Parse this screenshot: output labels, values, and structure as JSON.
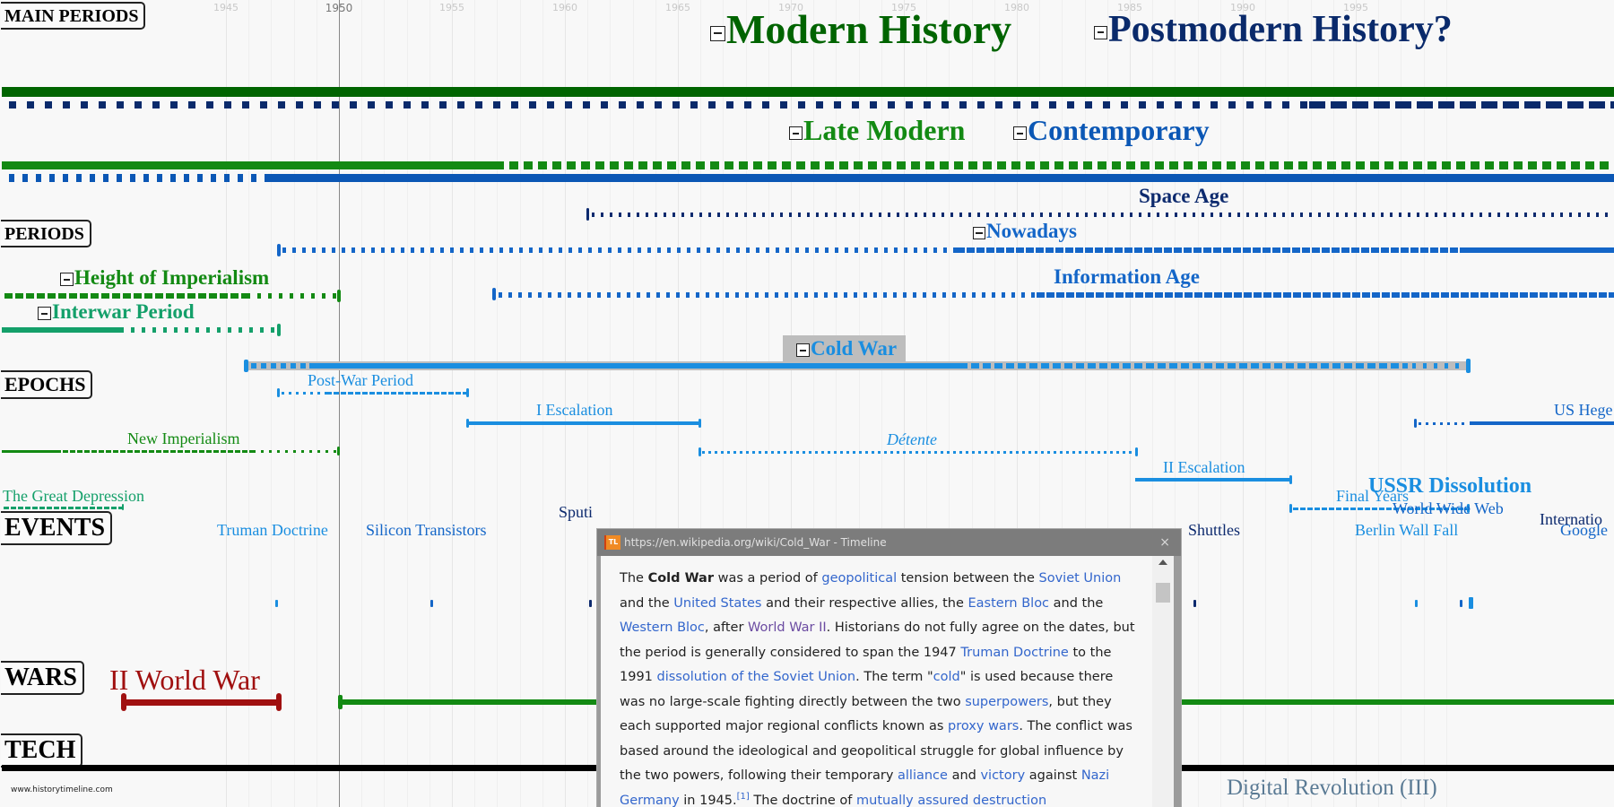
{
  "axis": {
    "ticks": [
      {
        "year": 1945,
        "label": "1945"
      },
      {
        "year": 1950,
        "label": "1950",
        "current": true
      },
      {
        "year": 1955,
        "label": "1955"
      },
      {
        "year": 1960,
        "label": "1960"
      },
      {
        "year": 1965,
        "label": "1965"
      },
      {
        "year": 1970,
        "label": "1970"
      },
      {
        "year": 1975,
        "label": "1975"
      },
      {
        "year": 1980,
        "label": "1980"
      },
      {
        "year": 1985,
        "label": "1985"
      },
      {
        "year": 1990,
        "label": "1990"
      },
      {
        "year": 1995,
        "label": "1995"
      }
    ]
  },
  "sections": {
    "main_periods": "MAIN PERIODS",
    "periods": "PERIODS",
    "epochs": "EPOCHS",
    "events": "EVENTS",
    "wars": "WARS",
    "tech": "TECH"
  },
  "main_periods": {
    "modern_history": {
      "label": "Modern History",
      "color": "#006400"
    },
    "postmodern_history": {
      "label": "Postmodern History?",
      "color": "#0a2a6b"
    },
    "late_modern": {
      "label": "Late Modern",
      "color": "#138a13"
    },
    "contemporary": {
      "label": "Contemporary",
      "color": "#0b57b5"
    }
  },
  "periods": {
    "space_age": {
      "label": "Space Age",
      "color": "#0d2a6e",
      "start": 1957
    },
    "nowadays": {
      "label": "Nowadays",
      "color": "#1466c8",
      "start": 1945
    },
    "information_age": {
      "label": "Information Age",
      "color": "#1466c8",
      "start": 1954
    },
    "height_of_imperialism": {
      "label": "Height of Imperialism",
      "color": "#138a13",
      "end": 1950
    },
    "interwar_period": {
      "label": "Interwar Period",
      "color": "#14a06a",
      "end": 1945
    }
  },
  "epochs": {
    "cold_war": {
      "label": "Cold War",
      "color": "#1a8ee0",
      "start": 1947,
      "end": 1991
    },
    "post_war_period": {
      "label": "Post-War Period",
      "color": "#1a8ee0",
      "start": 1945,
      "end": 1953
    },
    "i_escalation": {
      "label": "I Escalation",
      "color": "#1a8ee0",
      "start": 1953,
      "end": 1962
    },
    "new_imperialism": {
      "label": "New Imperialism",
      "color": "#138a13",
      "end": 1950
    },
    "detente": {
      "label": "Détente",
      "color": "#1a8ee0",
      "start": 1962,
      "end": 1979
    },
    "ii_escalation": {
      "label": "II Escalation",
      "color": "#1a8ee0",
      "start": 1979,
      "end": 1985
    },
    "final_years": {
      "label": "Final Years",
      "color": "#1a8ee0",
      "start": 1985,
      "end": 1991
    },
    "great_depression": {
      "label": "The Great Depression",
      "color": "#14a06a"
    },
    "us_hegemony": {
      "label": "US Hege",
      "color": "#1466c8",
      "start": 1989
    }
  },
  "events": [
    {
      "label": "Truman Doctrine",
      "year": 1947,
      "color": "#1a8ee0"
    },
    {
      "label": "Silicon Transistors",
      "year": 1954,
      "color": "#1466c8"
    },
    {
      "label": "Sputi",
      "year": 1957,
      "color": "#0d2a6e"
    },
    {
      "label": "Shuttles",
      "year": 1981,
      "color": "#0d2a6e"
    },
    {
      "label": "Berlin Wall Fall",
      "year": 1989,
      "color": "#1a8ee0"
    },
    {
      "label": "World Wide Web",
      "year": 1990,
      "color": "#1466c8"
    },
    {
      "label": "USSR Dissolution",
      "year": 1991,
      "color": "#1a8ee0"
    },
    {
      "label": "Internatio",
      "year": 1996,
      "color": "#0d2a6e"
    },
    {
      "label": "Google",
      "year": 1998,
      "color": "#1466c8"
    }
  ],
  "wars": {
    "ii_world_war": {
      "label": "II World War",
      "color": "#a01010",
      "start": 1939,
      "end": 1945
    }
  },
  "tech": {
    "digital_revolution": {
      "label": "Digital Revolution (III)",
      "color": "#5a7a94"
    }
  },
  "footer": "www.historytimeline.com",
  "popup": {
    "favicon": "TL",
    "title": "https://en.wikipedia.org/wiki/Cold_War - Timeline",
    "close": "×",
    "segments": [
      {
        "t": "The "
      },
      {
        "t": "Cold War",
        "b": true
      },
      {
        "t": " was a period of "
      },
      {
        "t": "geopolitical",
        "a": true
      },
      {
        "t": " tension between the "
      },
      {
        "t": "Soviet Union",
        "a": true
      },
      {
        "t": " and the "
      },
      {
        "t": "United States",
        "a": true
      },
      {
        "t": " and their respective allies, the "
      },
      {
        "t": "Eastern Bloc",
        "a": true
      },
      {
        "t": " and the "
      },
      {
        "t": "Western Bloc",
        "a": true
      },
      {
        "t": ", after "
      },
      {
        "t": "World War II",
        "a": true,
        "v": true
      },
      {
        "t": ". Historians do not fully agree on the dates, but the period is generally considered to span the 1947 "
      },
      {
        "t": "Truman Doctrine",
        "a": true
      },
      {
        "t": " to the 1991 "
      },
      {
        "t": "dissolution of the Soviet Union",
        "a": true
      },
      {
        "t": ". The term \""
      },
      {
        "t": "cold",
        "a": true
      },
      {
        "t": "\" is used because there was no large-scale fighting directly between the two "
      },
      {
        "t": "superpowers",
        "a": true
      },
      {
        "t": ", but they each supported major regional conflicts known as "
      },
      {
        "t": "proxy wars",
        "a": true
      },
      {
        "t": ". The conflict was based around the ideological and geopolitical struggle for global influence by the two powers, following their temporary "
      },
      {
        "t": "alliance",
        "a": true
      },
      {
        "t": " and "
      },
      {
        "t": "victory",
        "a": true
      },
      {
        "t": " against "
      },
      {
        "t": "Nazi Germany",
        "a": true
      },
      {
        "t": " in 1945."
      },
      {
        "t": "[1]",
        "sup": true,
        "a": true
      },
      {
        "t": " The doctrine of "
      },
      {
        "t": "mutually assured destruction",
        "a": true
      }
    ]
  }
}
